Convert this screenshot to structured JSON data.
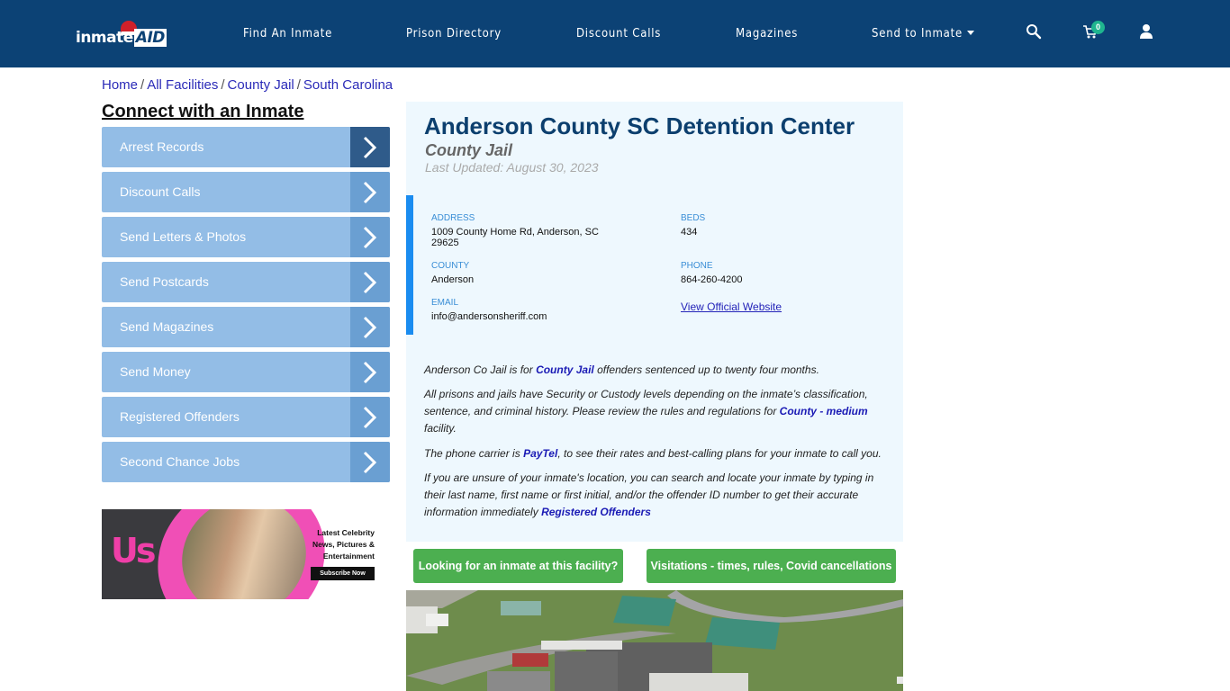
{
  "header": {
    "logo_text": "inmate",
    "logo_accent": "AID",
    "nav": [
      {
        "label": "Find An Inmate"
      },
      {
        "label": "Prison Directory"
      },
      {
        "label": "Discount Calls"
      },
      {
        "label": "Magazines"
      },
      {
        "label": "Send to Inmate",
        "has_dropdown": true
      }
    ],
    "icons": [
      "search-icon",
      "cart-icon",
      "user-icon"
    ],
    "cart_count": "0",
    "colors": {
      "bar": "#0c4275",
      "badge": "#1fb58f"
    }
  },
  "breadcrumb": [
    {
      "label": "Home"
    },
    {
      "label": "All Facilities"
    },
    {
      "label": "County Jail"
    },
    {
      "label": "South Carolina"
    }
  ],
  "sidebar": {
    "title": "Connect with an Inmate",
    "items": [
      {
        "label": "Arrest Records",
        "active": true
      },
      {
        "label": "Discount Calls"
      },
      {
        "label": "Send Letters & Photos"
      },
      {
        "label": "Send Postcards"
      },
      {
        "label": "Send Magazines"
      },
      {
        "label": "Send Money"
      },
      {
        "label": "Registered Offenders"
      },
      {
        "label": "Second Chance Jobs"
      }
    ],
    "ad": {
      "brand": "Us",
      "tagline": "Latest Celebrity News, Pictures & Entertainment",
      "button": "Subscribe Now"
    }
  },
  "facility": {
    "name": "Anderson County SC Detention Center",
    "type": "County Jail",
    "last_updated": "Last Updated: August 30, 2023",
    "address_label": "ADDRESS",
    "address": "1009 County Home Rd, Anderson, SC 29625",
    "beds_label": "BEDS",
    "beds": "434",
    "county_label": "COUNTY",
    "county": "Anderson",
    "phone_label": "PHONE",
    "phone": "864-260-4200",
    "email_label": "EMAIL",
    "email": "info@andersonsheriff.com",
    "website_link": "View Official Website"
  },
  "description": {
    "p1_a": "Anderson Co Jail is for ",
    "p1_link": "County Jail",
    "p1_b": " offenders sentenced up to twenty four months.",
    "p2_a": "All prisons and jails have Security or Custody levels depending on the inmate’s classification, sentence, and criminal history. Please review the rules and regulations for ",
    "p2_link": "County - medium",
    "p2_b": " facility.",
    "p3_a": "The phone carrier is ",
    "p3_link": "PayTel",
    "p3_b": ", to see their rates and best-calling plans for your inmate to call you.",
    "p4_a": "If you are unsure of your inmate's location, you can search and locate your inmate by typing in their last name, first name or first initial, and/or the offender ID number to get their accurate information immediately ",
    "p4_link": "Registered Offenders"
  },
  "actions": {
    "find_inmate": "Looking for an inmate at this facility?",
    "visitations": "Visitations - times, rules, Covid cancellations"
  }
}
